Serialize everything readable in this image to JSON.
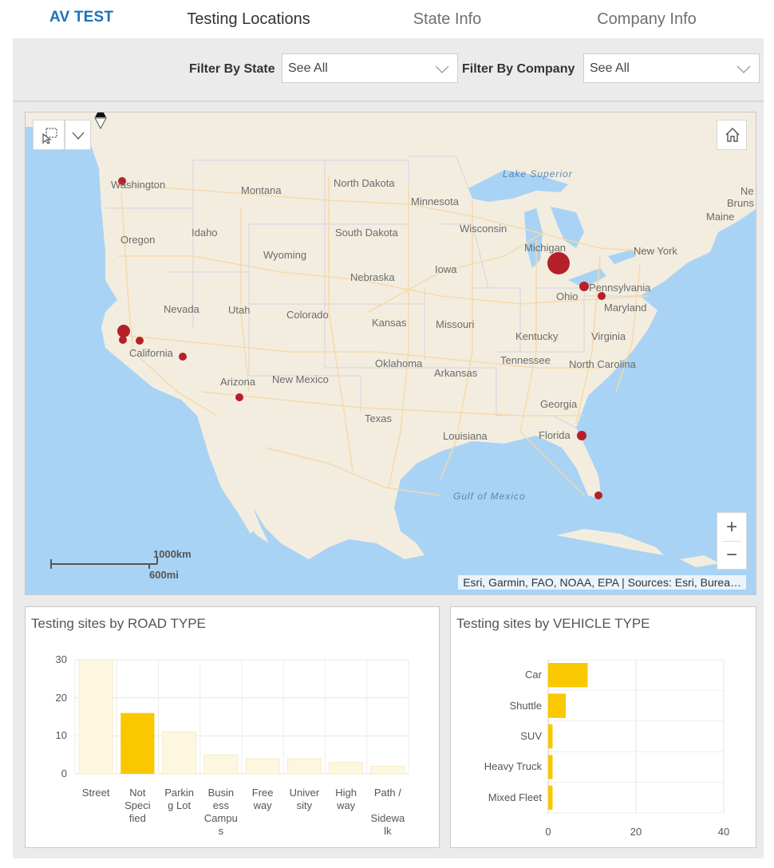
{
  "app": {
    "brand": "AV TEST"
  },
  "tabs": [
    {
      "label": "Testing Locations",
      "active": true
    },
    {
      "label": "State Info",
      "active": false
    },
    {
      "label": "Company Info",
      "active": false
    }
  ],
  "filters": {
    "state": {
      "label": "Filter By State",
      "value": "See All"
    },
    "company": {
      "label": "Filter By Company",
      "value": "See All"
    }
  },
  "map": {
    "attribution": "Esri, Garmin, FAO, NOAA, EPA | Sources: Esri, Burea…",
    "scale_km": "1000km",
    "scale_mi": "600mi",
    "zoom_in": "+",
    "zoom_out": "−",
    "labels": [
      "Washington",
      "Montana",
      "North Dakota",
      "Minnesota",
      "Oregon",
      "Idaho",
      "South Dakota",
      "Wisconsin",
      "Wyoming",
      "Michigan",
      "New York",
      "Nebraska",
      "Iowa",
      "Nevada",
      "Utah",
      "Ohio",
      "Pennsylvania",
      "Colorado",
      "Kansas",
      "Missouri",
      "Maryland",
      "California",
      "Kentucky",
      "Virginia",
      "Oklahoma",
      "Tennessee",
      "North Carolina",
      "Arkansas",
      "Arizona",
      "New Mexico",
      "Georgia",
      "Texas",
      "Louisiana",
      "Florida",
      "Maine",
      "Ne",
      "Bruns"
    ],
    "water_labels": [
      "Lake Superior",
      "Gulf of Mexico"
    ],
    "icons": {
      "select": "select-icon",
      "dropdown": "chevron-down-icon",
      "home": "home-icon",
      "compass": "compass-icon"
    },
    "colors": {
      "water": "#a9d3f4",
      "land": "#f3ede0",
      "road": "#f6d9a8",
      "point": "#b5202a"
    }
  },
  "charts": {
    "road": {
      "title": "Testing sites by ROAD TYPE",
      "y_ticks": [
        "30",
        "20",
        "10",
        "0"
      ],
      "cat_lines": [
        [
          "Street"
        ],
        [
          "Not",
          "Speci",
          "fied"
        ],
        [
          "Parkin",
          "g Lot"
        ],
        [
          "Busin",
          "ess",
          "Campu",
          "s"
        ],
        [
          "Free",
          "way"
        ],
        [
          "Univer",
          "sity"
        ],
        [
          "High",
          "way"
        ],
        [
          "Path /",
          "",
          "Sidewa",
          "lk"
        ]
      ]
    },
    "vehicle": {
      "title": "Testing sites by VEHICLE TYPE",
      "x_ticks": [
        "0",
        "20",
        "40"
      ]
    }
  },
  "chart_data": [
    {
      "type": "bar",
      "title": "Testing sites by ROAD TYPE",
      "categories": [
        "Street",
        "Not Specified",
        "Parking Lot",
        "Business Campus",
        "Freeway",
        "University",
        "Highway",
        "Path / Sidewalk"
      ],
      "values": [
        30,
        16,
        11,
        5,
        4,
        4,
        3,
        2
      ],
      "highlighted": "Not Specified",
      "ylim": [
        0,
        30
      ],
      "colors": {
        "highlight": "#f9c800",
        "faded": "#fdf7df"
      }
    },
    {
      "type": "bar",
      "orientation": "horizontal",
      "title": "Testing sites by VEHICLE TYPE",
      "categories": [
        "Car",
        "Shuttle",
        "SUV",
        "Heavy Truck",
        "Mixed Fleet"
      ],
      "values": [
        9,
        4,
        1,
        1,
        1
      ],
      "xlim": [
        0,
        40
      ],
      "colors": {
        "bar": "#f9c800"
      }
    }
  ]
}
